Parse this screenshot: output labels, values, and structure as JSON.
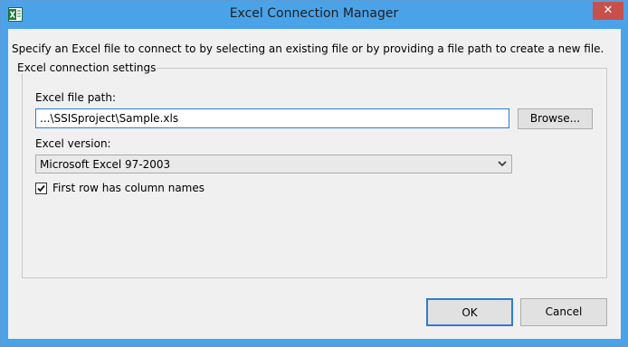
{
  "window": {
    "title": "Excel Connection Manager",
    "close_glyph": "✕",
    "accent": "#4aa3e8"
  },
  "description": "Specify an Excel file to connect to by selecting an existing file or by providing a file path to create a new file.",
  "group": {
    "title": "Excel connection settings",
    "file_path_label": "Excel file path:",
    "file_path_value": "...\\SSISproject\\Sample.xls",
    "browse_label": "Browse...",
    "version_label": "Excel version:",
    "version_value": "Microsoft Excel 97-2003",
    "checkbox_label": "First row has column names",
    "checkbox_checked": true
  },
  "buttons": {
    "ok": "OK",
    "cancel": "Cancel"
  },
  "icons": {
    "app": "excel-icon",
    "close": "close-icon",
    "dropdown": "chevron-down-icon",
    "check": "checkmark-icon"
  }
}
